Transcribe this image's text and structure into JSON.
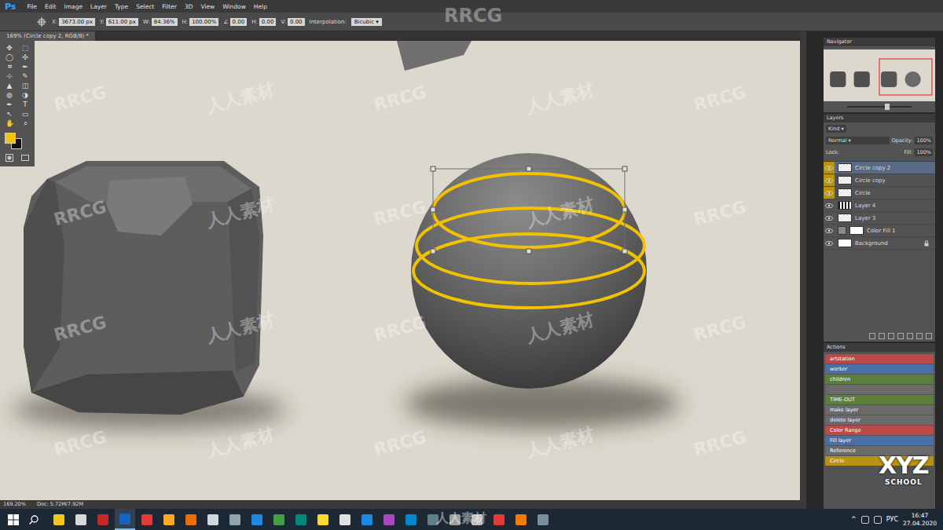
{
  "app": {
    "logo": "Ps",
    "menu": [
      "File",
      "Edit",
      "Image",
      "Layer",
      "Type",
      "Select",
      "Filter",
      "3D",
      "View",
      "Window",
      "Help"
    ]
  },
  "options_bar": {
    "fields": [
      {
        "label": "X:",
        "value": "3673.00 px"
      },
      {
        "label": "Y:",
        "value": "611.00 px"
      },
      {
        "label": "W:",
        "value": "84.36%"
      },
      {
        "label": "H:",
        "value": "100.00%"
      },
      {
        "label": "∠",
        "value": "0.00"
      },
      {
        "label": "H:",
        "value": "0.00"
      },
      {
        "label": "V:",
        "value": "0.00"
      }
    ],
    "interpolation_label": "Interpolation:",
    "interpolation": "Bicubic"
  },
  "document": {
    "tab": "169% (Circle copy 2, RGB/8) *"
  },
  "tools": [
    "✥",
    "⬚",
    "◯",
    "✣",
    "⌗",
    "✒",
    "⊹",
    "✎",
    "▲",
    "◫",
    "◍",
    "◑",
    "✒",
    "T",
    "↖",
    "▭",
    "✋",
    "⌕"
  ],
  "navigator": {
    "title": "Navigator"
  },
  "layers": {
    "title": "Layers",
    "filter": "Kind",
    "blend_mode": "Normal",
    "opacity_label": "Opacity:",
    "opacity": "100%",
    "lock_label": "Lock:",
    "fill_label": "Fill:",
    "fill": "100%",
    "items": [
      {
        "name": "Circle copy 2",
        "visible": true,
        "selected": true,
        "color": "#b8930f",
        "kind": "pixel"
      },
      {
        "name": "Circle copy",
        "visible": true,
        "selected": false,
        "color": "#b8930f",
        "kind": "pixel"
      },
      {
        "name": "Circle",
        "visible": true,
        "selected": false,
        "color": "#b8930f",
        "kind": "pixel"
      },
      {
        "name": "Layer 4",
        "visible": true,
        "selected": false,
        "color": "#535353",
        "kind": "pattern"
      },
      {
        "name": "Layer 3",
        "visible": true,
        "selected": false,
        "color": "#535353",
        "kind": "pixel"
      },
      {
        "name": "Color Fill 1",
        "visible": true,
        "selected": false,
        "color": "#535353",
        "kind": "fill"
      },
      {
        "name": "Background",
        "visible": true,
        "selected": false,
        "color": "#535353",
        "kind": "background"
      }
    ]
  },
  "actions": {
    "title": "Actions",
    "items": [
      {
        "label": "artstation",
        "color": "#b94a48"
      },
      {
        "label": "worker",
        "color": "#4a6fa5"
      },
      {
        "label": "children",
        "color": "#5b7f3a"
      },
      {
        "label": "",
        "color": "#6a6a6a"
      },
      {
        "label": "TIME-OUT",
        "color": "#5b7f3a"
      },
      {
        "label": "make layer",
        "color": "#6a6a6a"
      },
      {
        "label": "delete layer",
        "color": "#6a6a6a"
      },
      {
        "label": "Color Range",
        "color": "#b94a48"
      },
      {
        "label": "Fill layer",
        "color": "#4a6fa5"
      },
      {
        "label": "Reference",
        "color": "#6a6a6a"
      },
      {
        "label": "Circle",
        "color": "#b8930f"
      }
    ]
  },
  "status_bar": {
    "zoom": "169.20%",
    "doc": "Doc: 5.72M/7.92M"
  },
  "taskbar": {
    "tray": "^",
    "language": "РУС",
    "time": "16:47",
    "date": "27.04.2020"
  },
  "watermark": {
    "top": "RRCG",
    "tiles": [
      "RRCG",
      "人人素材"
    ],
    "bottom": "人人素材"
  },
  "badge": {
    "line1": "XYZ",
    "line2": "SCHOOL"
  }
}
